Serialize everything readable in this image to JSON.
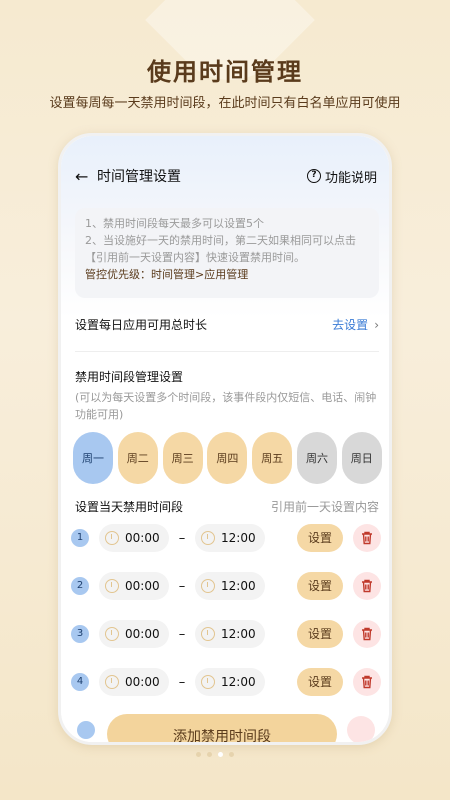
{
  "promo": {
    "title": "使用时间管理",
    "subtitle": "设置每周每一天禁用时间段，在此时间只有白名单应用可使用"
  },
  "header": {
    "title": "时间管理设置",
    "help_label": "功能说明"
  },
  "notice": {
    "line1": "1、禁用时间段每天最多可以设置5个",
    "line2": "2、当设施好一天的禁用时间，第二天如果相同可以点击【引用前一天设置内容】快速设置禁用时间。",
    "priority": "管控优先级：时间管理>应用管理"
  },
  "daily_total": {
    "label": "设置每日应用可用总时长",
    "action": "去设置"
  },
  "disabled_periods": {
    "title": "禁用时间段管理设置",
    "desc": "(可以为每天设置多个时间段，该事件段内仅短信、电话、闹钟功能可用)"
  },
  "days": [
    {
      "label": "周一",
      "state": "selected"
    },
    {
      "label": "周二",
      "state": "enabled"
    },
    {
      "label": "周三",
      "state": "enabled"
    },
    {
      "label": "周四",
      "state": "enabled"
    },
    {
      "label": "周五",
      "state": "enabled"
    },
    {
      "label": "周六",
      "state": "disabled"
    },
    {
      "label": "周日",
      "state": "disabled"
    }
  ],
  "slots_section": {
    "title": "设置当天禁用时间段",
    "reference_label": "引用前一天设置内容"
  },
  "slots": [
    {
      "num": "1",
      "start": "00:00",
      "end": "12:00",
      "set_label": "设置"
    },
    {
      "num": "2",
      "start": "00:00",
      "end": "12:00",
      "set_label": "设置"
    },
    {
      "num": "3",
      "start": "00:00",
      "end": "12:00",
      "set_label": "设置"
    },
    {
      "num": "4",
      "start": "00:00",
      "end": "12:00",
      "set_label": "设置"
    }
  ],
  "add_button": "添加禁用时间段",
  "colors": {
    "accent": "#f5d8a5",
    "selected_day": "#a8c8f0",
    "link": "#3a7bd5",
    "delete_bg": "#fde4e4",
    "delete_icon": "#c0392b"
  }
}
